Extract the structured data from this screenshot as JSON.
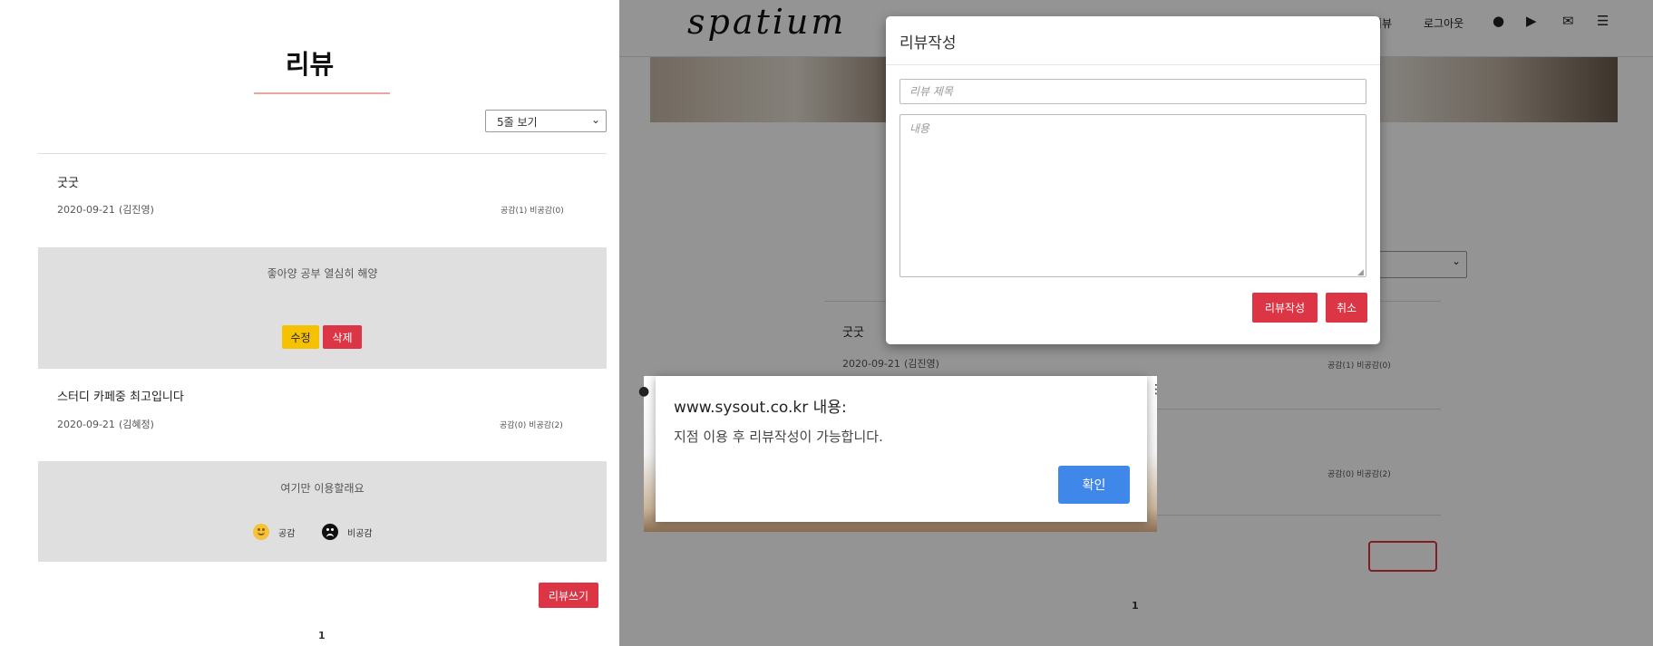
{
  "left": {
    "title": "리뷰",
    "sort_select": "5줄 보기",
    "reviews": [
      {
        "title": "굿굿",
        "date": "2020-09-21",
        "author": "(김진영)",
        "votes": "공감(1) 비공감(0)",
        "content": "좋아양 공부 열심히 해양",
        "edit_label": "수정",
        "delete_label": "삭제"
      },
      {
        "title": "스터디 카페중 최고입니다",
        "date": "2020-09-21",
        "author": "(김혜정)",
        "votes": "공감(0) 비공감(2)",
        "content": "여기만 이용할래요",
        "like_label": "공감",
        "dislike_label": "비공감"
      }
    ],
    "write_button": "리뷰쓰기",
    "page": "1"
  },
  "right": {
    "logo": "spatium",
    "nav": {
      "review": "리뷰",
      "logout": "로그아웃"
    },
    "nav_icons": [
      "user-icon",
      "ticket-icon",
      "mail-icon",
      "menu-icon"
    ],
    "reviews": [
      {
        "title": "굿굿",
        "date": "2020-09-21",
        "author": "(김진영)",
        "votes": "공감(1) 비공감(0)"
      },
      {
        "votes": "공감(0) 비공감(2)"
      }
    ],
    "page": "1",
    "modal": {
      "title": "리뷰작성",
      "title_placeholder": "리뷰 제목",
      "content_placeholder": "내용",
      "submit_label": "리뷰작성",
      "cancel_label": "취소"
    },
    "alert": {
      "title": "www.sysout.co.kr 내용:",
      "message": "지점 이용 후 리뷰작성이 가능합니다.",
      "ok_label": "확인"
    }
  },
  "colors": {
    "accent_red": "#dc3545",
    "edit_yellow": "#f5c100",
    "alert_blue": "#3f87e8",
    "review_box": "#dfdfdf"
  }
}
